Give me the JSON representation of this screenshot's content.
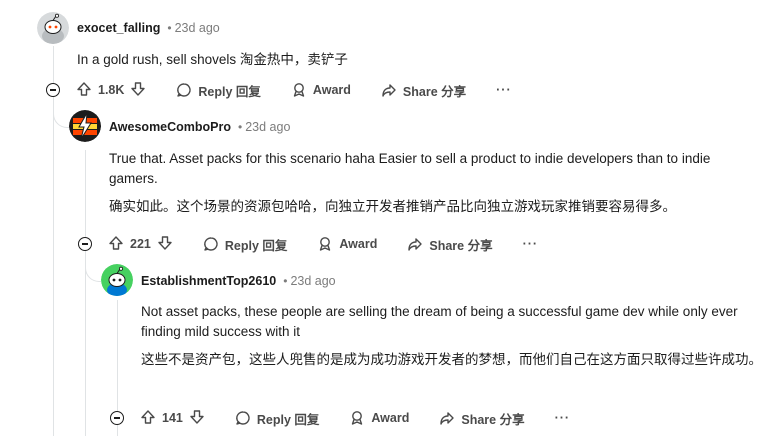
{
  "comments": [
    {
      "author": "exocet_falling",
      "separator": "•",
      "time": "23d ago",
      "text": [
        "In a gold rush, sell shovels 淘金热中，卖铲子"
      ],
      "score": "1.8K",
      "reply_label": "Reply 回复",
      "award_label": "Award",
      "share_label": "Share 分享",
      "more_label": "···"
    },
    {
      "author": "AwesomeComboPro",
      "separator": "•",
      "time": "23d ago",
      "text": [
        "True that. Asset packs for this scenario haha Easier to sell a product to indie developers than to indie gamers.",
        "确实如此。这个场景的资源包哈哈，向独立开发者推销产品比向独立游戏玩家推销要容易得多。"
      ],
      "score": "221",
      "reply_label": "Reply 回复",
      "award_label": "Award",
      "share_label": "Share 分享",
      "more_label": "···"
    },
    {
      "author": "EstablishmentTop2610",
      "separator": "•",
      "time": "23d ago",
      "text": [
        "Not asset packs, these people are selling the dream of being a successful game dev while only ever finding mild success with it",
        "这些不是资产包，这些人兜售的是成为成功游戏开发者的梦想，而他们自己在这方面只取得过些许成功。"
      ],
      "score": "141",
      "reply_label": "Reply 回复",
      "award_label": "Award",
      "share_label": "Share 分享",
      "more_label": "···"
    }
  ],
  "colors": {
    "thread_line": "#e0e3e5",
    "meta_text": "#7c7c7c",
    "action_text": "#4a4a4a",
    "avatar3_bg": "#46d160"
  },
  "icons": [
    "upvote-icon",
    "downvote-icon",
    "reply-bubble-icon",
    "award-icon",
    "share-icon",
    "collapse-icon"
  ]
}
